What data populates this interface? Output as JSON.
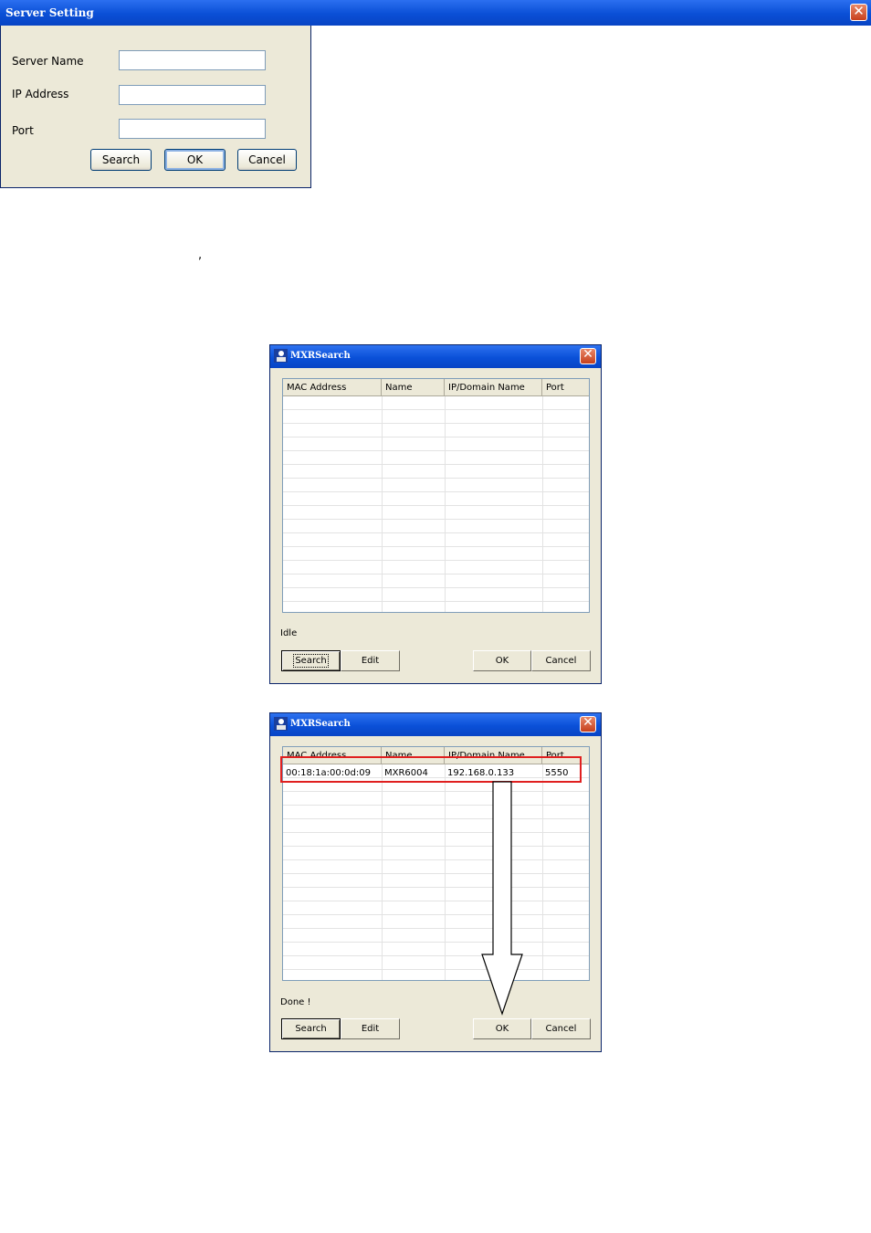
{
  "server_setting": {
    "title": "Server Setting",
    "fields": [
      {
        "label": "Server Name",
        "value": ""
      },
      {
        "label": "IP Address",
        "value": ""
      },
      {
        "label": "Port",
        "value": ""
      }
    ],
    "buttons": {
      "search": "Search",
      "ok": "OK",
      "cancel": "Cancel"
    }
  },
  "stray_mark": ",",
  "mxr_search_idle": {
    "title": "MXRSearch",
    "columns": [
      "MAC Address",
      "Name",
      "IP/Domain Name",
      "Port"
    ],
    "rows": [],
    "status": "Idle",
    "buttons": {
      "search": "Search",
      "edit": "Edit",
      "ok": "OK",
      "cancel": "Cancel"
    }
  },
  "mxr_search_done": {
    "title": "MXRSearch",
    "columns": [
      "MAC Address",
      "Name",
      "IP/Domain Name",
      "Port"
    ],
    "rows": [
      {
        "mac": "00:18:1a:00:0d:09",
        "name": "MXR6004",
        "ip": "192.168.0.133",
        "port": "5550"
      }
    ],
    "status": "Done !",
    "buttons": {
      "search": "Search",
      "edit": "Edit",
      "ok": "OK",
      "cancel": "Cancel"
    }
  },
  "colors": {
    "highlight_box": "#e02020",
    "xp_title": "#0a4fd6",
    "dialog_bg": "#ece9d8"
  }
}
